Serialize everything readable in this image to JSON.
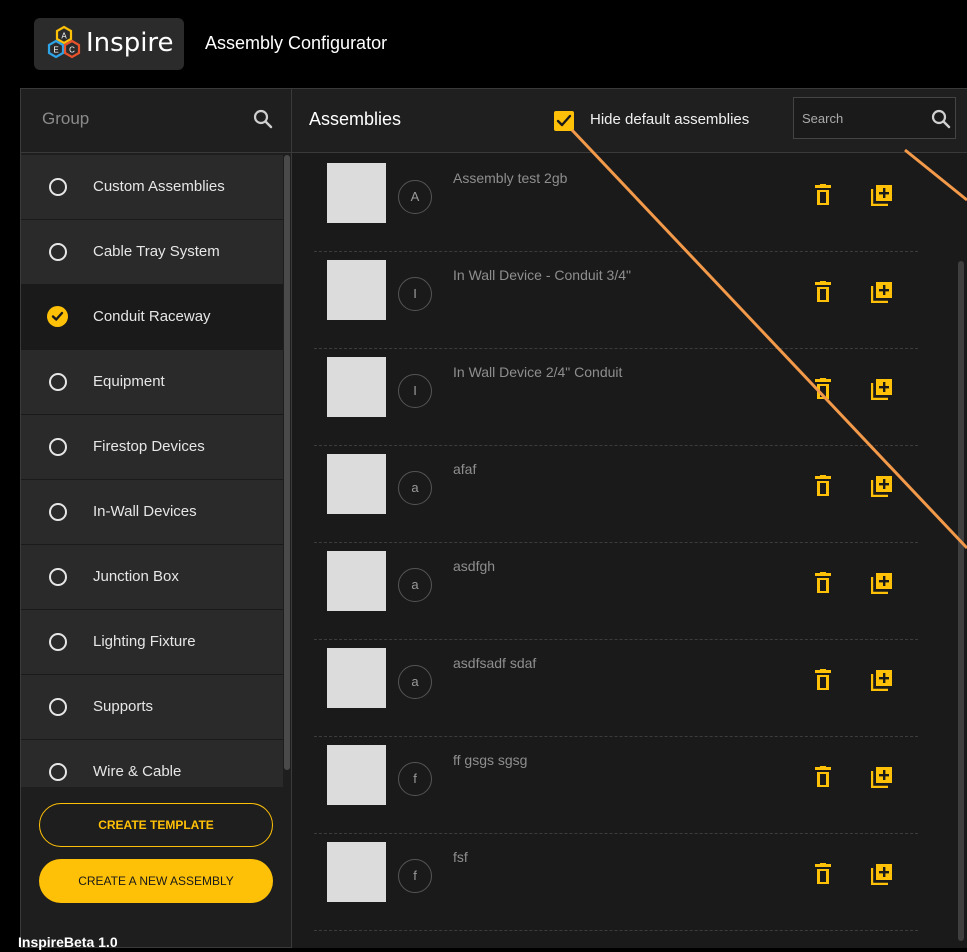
{
  "app": {
    "logo_text": "Inspire",
    "title": "Assembly Configurator",
    "version": "InspireBeta 1.0",
    "accent_color": "#ffc107"
  },
  "group_panel": {
    "label": "Group",
    "search_icon": "search-icon",
    "items": [
      {
        "label": "Custom Assemblies",
        "selected": false
      },
      {
        "label": "Cable Tray System",
        "selected": false
      },
      {
        "label": "Conduit Raceway",
        "selected": true
      },
      {
        "label": "Equipment",
        "selected": false
      },
      {
        "label": "Firestop Devices",
        "selected": false
      },
      {
        "label": "In-Wall Devices",
        "selected": false
      },
      {
        "label": "Junction Box",
        "selected": false
      },
      {
        "label": "Lighting Fixture",
        "selected": false
      },
      {
        "label": "Supports",
        "selected": false
      },
      {
        "label": "Wire & Cable",
        "selected": false
      }
    ],
    "create_template_label": "CREATE TEMPLATE",
    "create_assembly_label": "CREATE A NEW ASSEMBLY"
  },
  "assemblies_panel": {
    "title": "Assemblies",
    "hide_default_label": "Hide default assemblies",
    "hide_default_checked": true,
    "search_placeholder": "Search",
    "items": [
      {
        "initial": "A",
        "name": "Assembly test 2gb"
      },
      {
        "initial": "I",
        "name": "In Wall Device - Conduit 3/4\""
      },
      {
        "initial": "I",
        "name": "In Wall Device 2/4\" Conduit"
      },
      {
        "initial": "a",
        "name": "afaf"
      },
      {
        "initial": "a",
        "name": "asdfgh"
      },
      {
        "initial": "a",
        "name": "asdfsadf sdaf"
      },
      {
        "initial": "f",
        "name": "ff gsgs sgsg"
      },
      {
        "initial": "f",
        "name": "fsf"
      }
    ]
  }
}
